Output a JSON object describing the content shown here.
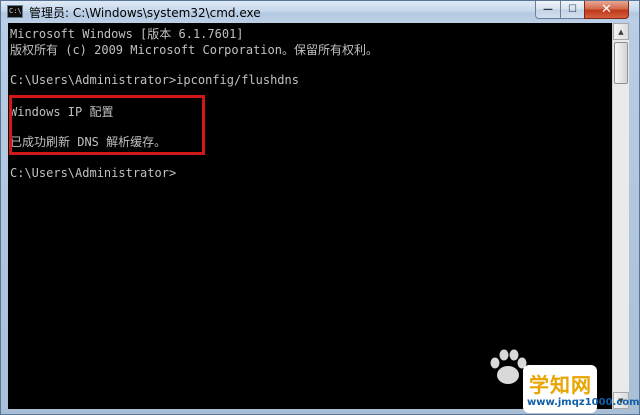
{
  "window": {
    "title": "管理员: C:\\Windows\\system32\\cmd.exe",
    "icon_text": "C:\\",
    "buttons": {
      "minimize": "—",
      "maximize": "☐",
      "close": "✕"
    }
  },
  "console": {
    "lines": [
      "Microsoft Windows [版本 6.1.7601]",
      "版权所有 (c) 2009 Microsoft Corporation。保留所有权利。",
      "",
      "C:\\Users\\Administrator>ipconfig/flushdns",
      "",
      "Windows IP 配置",
      "",
      "已成功刷新 DNS 解析缓存。",
      "",
      "C:\\Users\\Administrator>"
    ]
  },
  "watermark": {
    "title": "学知网",
    "url": "www.jmqz1000.com"
  },
  "colors": {
    "console_background": "#000000",
    "console_text": "#c0c0c0",
    "highlight_border": "#d01818",
    "close_button": "#c0391b"
  },
  "icons": {
    "app": "cmd-icon",
    "scroll_up": "triangle-up-icon",
    "scroll_down": "triangle-down-icon",
    "watermark_logo": "paw-icon"
  }
}
